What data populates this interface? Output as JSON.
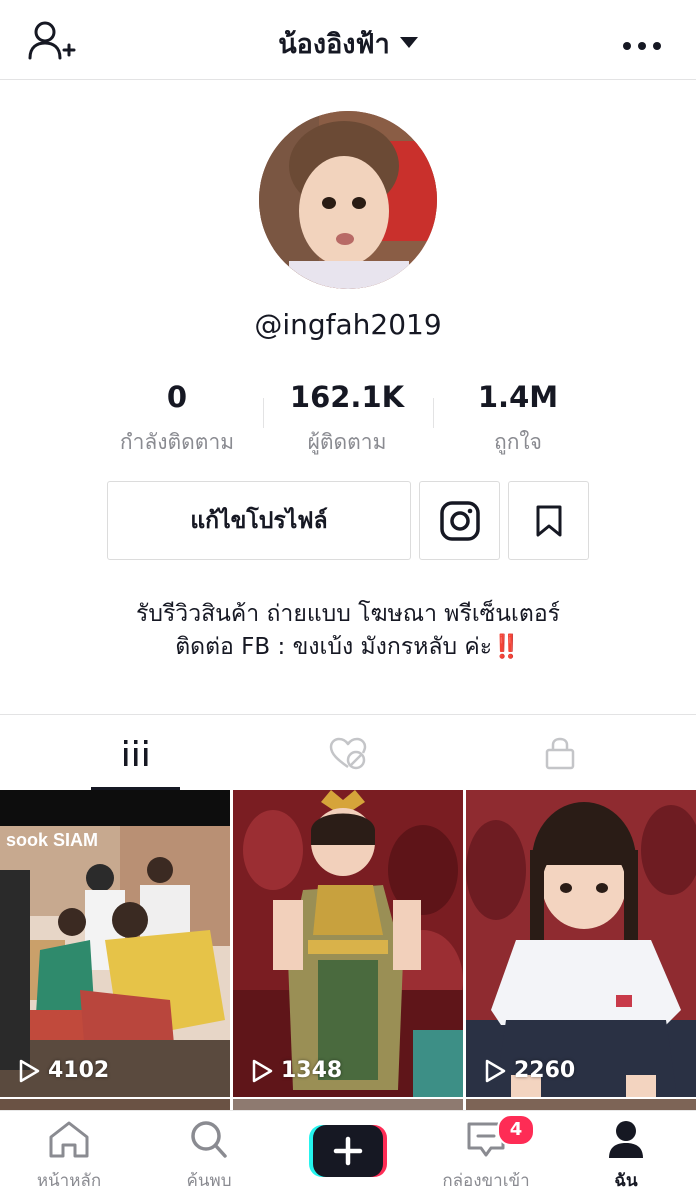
{
  "header": {
    "title": "น้องอิงฟ้า",
    "add_user_icon": "add-user-icon",
    "more_icon": "more-horizontal-icon"
  },
  "profile": {
    "username": "@ingfah2019",
    "stats": [
      {
        "value": "0",
        "label": "กำลังติดตาม"
      },
      {
        "value": "162.1K",
        "label": "ผู้ติดตาม"
      },
      {
        "value": "1.4M",
        "label": "ถูกใจ"
      }
    ],
    "edit_profile_label": "แก้ไขโปรไฟล์",
    "instagram_icon": "instagram-icon",
    "bookmark_icon": "bookmark-icon",
    "bio_line1": "รับรีวิวสินค้า ถ่ายแบบ โฆษณา พรีเซ็นเตอร์",
    "bio_line2": "ติดต่อ FB : ขงเบ้ง มังกรหลับ ค่ะ‼️"
  },
  "tabs": [
    {
      "icon": "grid-icon",
      "active": true
    },
    {
      "icon": "liked-hidden-icon",
      "active": false
    },
    {
      "icon": "lock-icon",
      "active": false
    }
  ],
  "videos": [
    {
      "views": "4102",
      "overlay_text": "sook SIAM"
    },
    {
      "views": "1348"
    },
    {
      "views": "2260"
    }
  ],
  "bottom_nav": [
    {
      "label": "หน้าหลัก",
      "icon": "home-icon"
    },
    {
      "label": "ค้นพบ",
      "icon": "search-icon"
    },
    {
      "label": "",
      "icon": "plus-icon"
    },
    {
      "label": "กล่องขาเข้า",
      "icon": "inbox-icon",
      "badge": "4"
    },
    {
      "label": "ฉัน",
      "icon": "profile-icon",
      "active": true
    }
  ],
  "colors": {
    "accent_pink": "#fe2c55",
    "accent_cyan": "#25f4ee",
    "text": "#161823",
    "muted": "#8a8b91"
  }
}
